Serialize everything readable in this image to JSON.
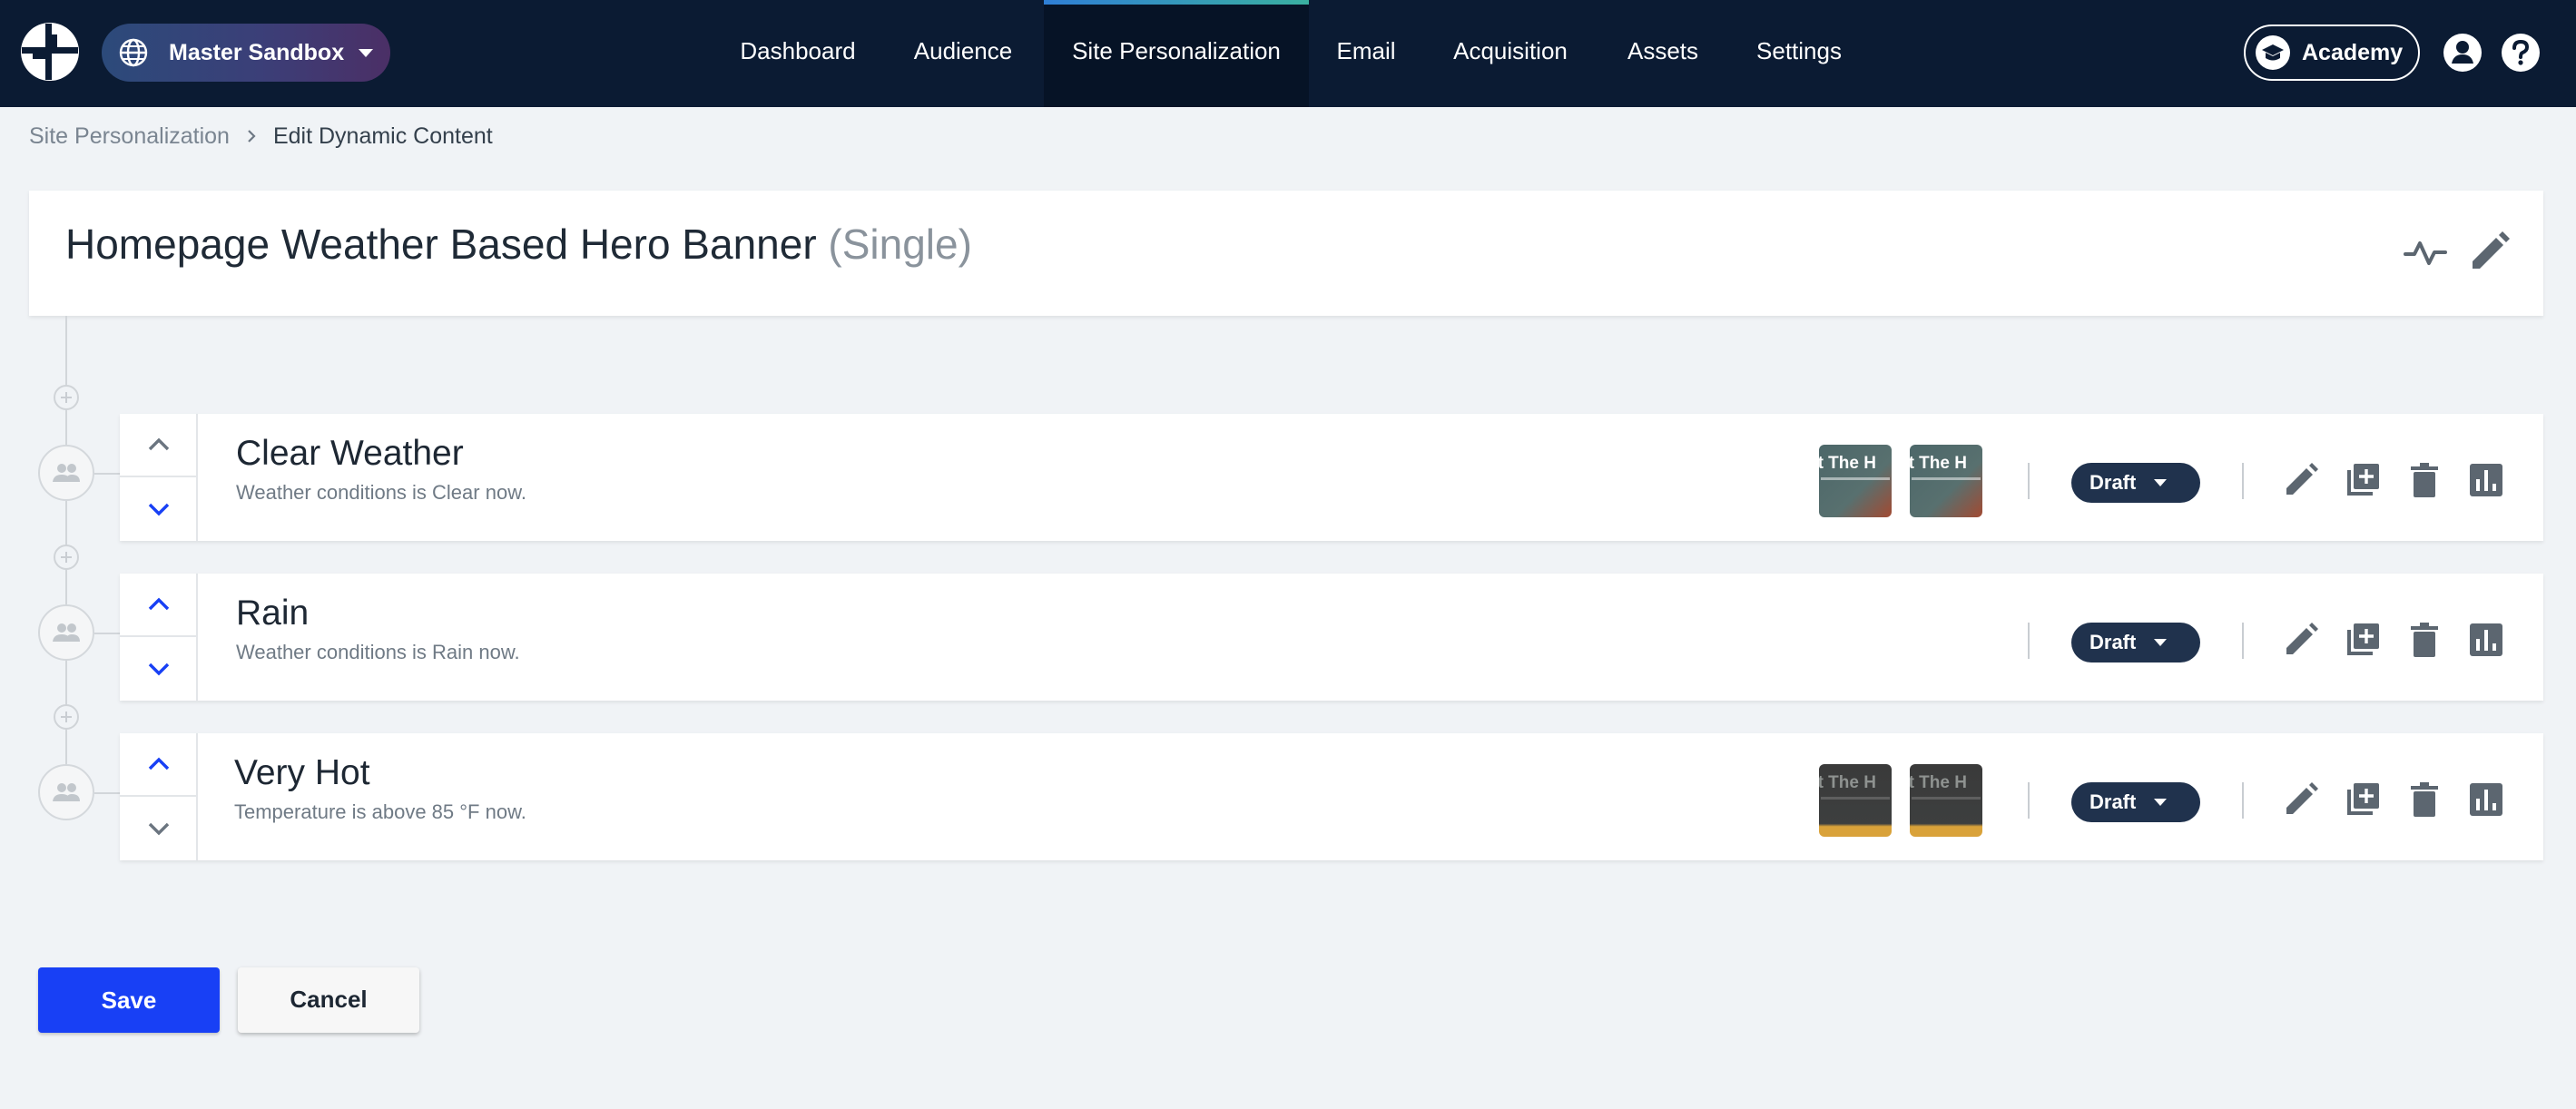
{
  "nav": {
    "sandbox_label": "Master Sandbox",
    "items": [
      {
        "label": "Dashboard",
        "active": false
      },
      {
        "label": "Audience",
        "active": false
      },
      {
        "label": "Site Personalization",
        "active": true
      },
      {
        "label": "Email",
        "active": false
      },
      {
        "label": "Acquisition",
        "active": false
      },
      {
        "label": "Assets",
        "active": false
      },
      {
        "label": "Settings",
        "active": false
      }
    ],
    "academy_label": "Academy",
    "icons": [
      "logo-icon",
      "globe-icon",
      "academy-icon",
      "user-icon",
      "help-icon"
    ]
  },
  "breadcrumb": {
    "parent": "Site Personalization",
    "current": "Edit Dynamic Content"
  },
  "header": {
    "title": "Homepage Weather Based Hero Banner",
    "type_label": "(Single)"
  },
  "rows": [
    {
      "name": "Clear Weather",
      "description": "Weather conditions is Clear now.",
      "status": "Draft",
      "thumbnails": [
        "at The H",
        "at The H"
      ],
      "thumb_style": "teal"
    },
    {
      "name": "Rain",
      "description": "Weather conditions is Rain now.",
      "status": "Draft",
      "thumbnails": [],
      "thumb_style": "none"
    },
    {
      "name": "Very Hot",
      "description": "Temperature is above 85 °F now.",
      "status": "Draft",
      "thumbnails": [
        "at The H",
        "at The H"
      ],
      "thumb_style": "dark"
    }
  ],
  "buttons": {
    "save": "Save",
    "cancel": "Cancel"
  },
  "colors": {
    "nav_bg": "#0b1b33",
    "primary": "#1840f5",
    "draft_badge": "#20324d",
    "page_bg": "#f0f3f6"
  }
}
